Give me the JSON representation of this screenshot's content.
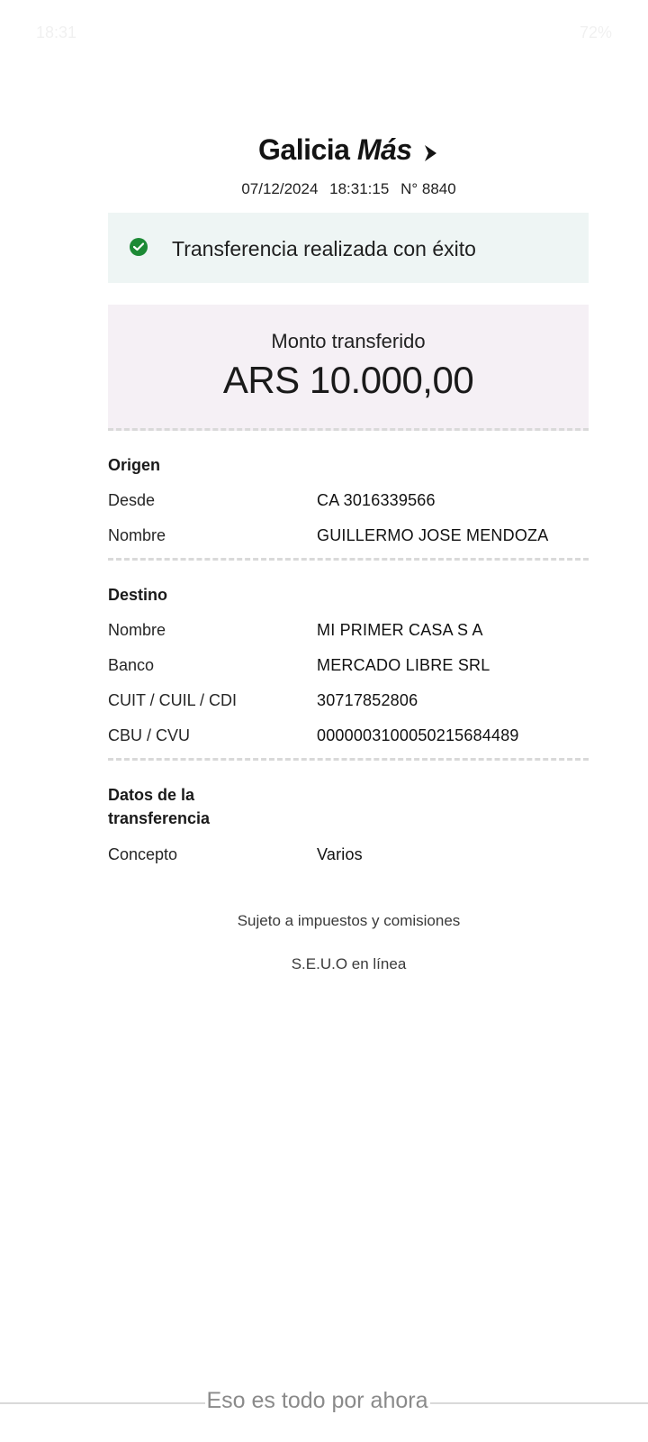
{
  "status_bar": {
    "time": "18:31",
    "battery": "72%"
  },
  "brand": {
    "name_main": "Galicia",
    "name_accent": "Más"
  },
  "receipt": {
    "date": "07/12/2024",
    "time": "18:31:15",
    "number": "N° 8840"
  },
  "success_message": "Transferencia realizada con éxito",
  "amount": {
    "label": "Monto transferido",
    "value": "ARS 10.000,00"
  },
  "origin": {
    "title": "Origen",
    "rows": [
      {
        "label": "Desde",
        "value": "CA 3016339566"
      },
      {
        "label": "Nombre",
        "value": "GUILLERMO JOSE MENDOZA"
      }
    ]
  },
  "destination": {
    "title": "Destino",
    "rows": [
      {
        "label": "Nombre",
        "value": "MI PRIMER CASA S A"
      },
      {
        "label": "Banco",
        "value": "MERCADO LIBRE SRL"
      },
      {
        "label": "CUIT / CUIL / CDI",
        "value": "30717852806"
      },
      {
        "label": "CBU / CVU",
        "value": "0000003100050215684489"
      }
    ]
  },
  "transfer_data": {
    "title_line1": "Datos de la",
    "title_line2": "transferencia",
    "rows": [
      {
        "label": "Concepto",
        "value": "Varios"
      }
    ]
  },
  "footnotes": {
    "taxes": "Sujeto a impuestos y comisiones",
    "seuo": "S.E.U.O en línea"
  },
  "bottom_hint": "Eso es todo por ahora",
  "colors": {
    "success_bg": "#eef5f4",
    "success_icon": "#1c8a35",
    "amount_bg": "#f5f0f5",
    "divider": "#d9d9d9"
  }
}
